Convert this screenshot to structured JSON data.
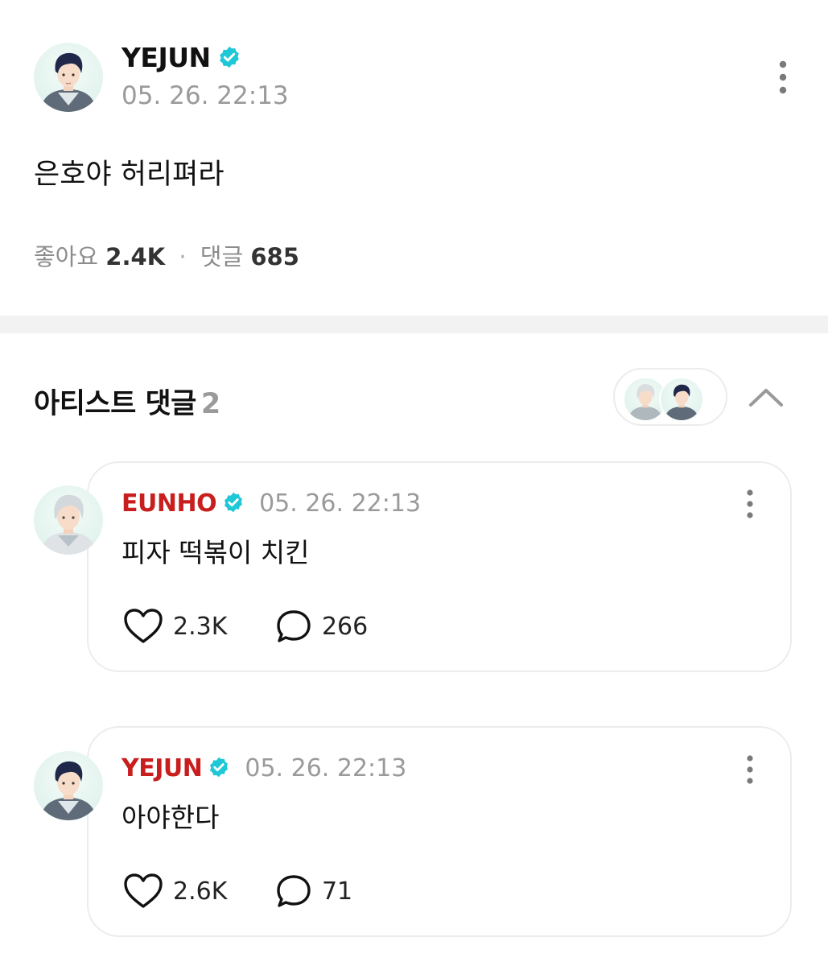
{
  "post": {
    "author": "YEJUN",
    "avatar_icon": "yejun-avatar",
    "verified_icon": "verified-badge-icon",
    "timestamp": "05. 26. 22:13",
    "body": "은호야 허리펴라",
    "likes_label": "좋아요",
    "likes_count": "2.4K",
    "separator": "·",
    "comments_label": "댓글",
    "comments_count": "685"
  },
  "artist_comments": {
    "title": "아티스트 댓글",
    "count": "2",
    "comments": [
      {
        "author": "EUNHO",
        "timestamp": "05. 26. 22:13",
        "body": "피자 떡볶이 치킨",
        "likes": "2.3K",
        "replies": "266"
      },
      {
        "author": "YEJUN",
        "timestamp": "05. 26. 22:13",
        "body": "아야한다",
        "likes": "2.6K",
        "replies": "71"
      }
    ]
  },
  "colors": {
    "accent_name": "#c81e1e",
    "verified": "#1ec8d6",
    "muted_text": "#9a9a9a",
    "divider": "#f2f2f2"
  }
}
